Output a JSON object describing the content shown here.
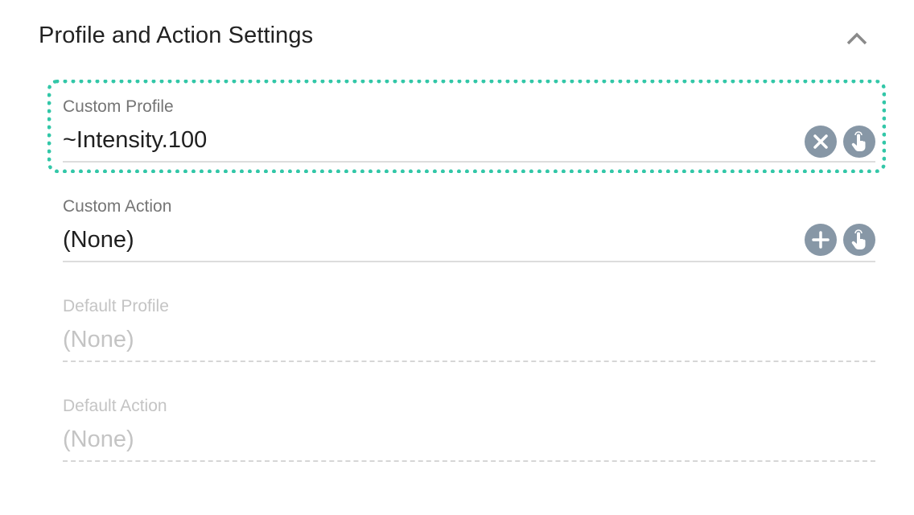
{
  "section": {
    "title": "Profile and Action Settings",
    "collapse_icon": "chevron-up-icon"
  },
  "colors": {
    "focus_outline": "#33c7a8",
    "icon_button_bg": "#8797a6",
    "label": "#757575",
    "disabled": "#c4c4c4"
  },
  "fields": [
    {
      "label": "Custom Profile",
      "value": "~Intensity.100",
      "enabled": true,
      "focused": true,
      "buttons": [
        "clear-icon",
        "tap-select-icon"
      ]
    },
    {
      "label": "Custom Action",
      "value": "(None)",
      "enabled": true,
      "focused": false,
      "buttons": [
        "add-icon",
        "tap-select-icon"
      ]
    },
    {
      "label": "Default Profile",
      "value": "(None)",
      "enabled": false
    },
    {
      "label": "Default Action",
      "value": "(None)",
      "enabled": false
    }
  ]
}
